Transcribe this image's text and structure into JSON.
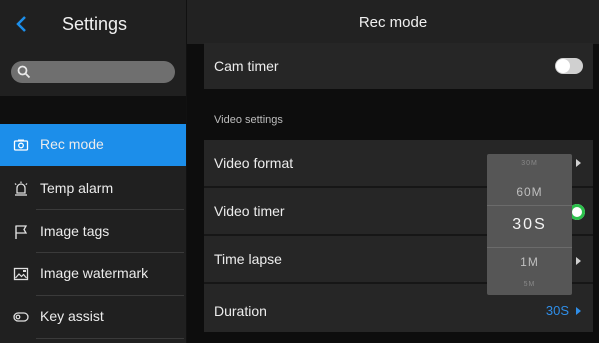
{
  "left_panel": {
    "title": "Settings",
    "search": {
      "placeholder": ""
    },
    "items": [
      {
        "label": "Rec mode",
        "icon": "camera-icon",
        "active": true
      },
      {
        "label": "Temp alarm",
        "icon": "alarm-icon",
        "active": false
      },
      {
        "label": "Image tags",
        "icon": "flag-icon",
        "active": false
      },
      {
        "label": "Image watermark",
        "icon": "watermark-icon",
        "active": false
      },
      {
        "label": "Key assist",
        "icon": "key-assist-icon",
        "active": false
      }
    ]
  },
  "right_panel": {
    "title": "Rec mode",
    "cam_timer": {
      "label": "Cam timer",
      "enabled": false
    },
    "section_title": "Video settings",
    "video_format": {
      "label": "Video format"
    },
    "video_timer": {
      "label": "Video timer",
      "enabled": true
    },
    "time_lapse": {
      "label": "Time lapse"
    },
    "duration": {
      "label": "Duration",
      "value": "30S"
    }
  },
  "picker": {
    "options": [
      "30M",
      "60M",
      "30S",
      "1M",
      "5M"
    ],
    "selected": "30S"
  },
  "colors": {
    "accent": "#1c8eea",
    "toggle_on": "#2bc04b",
    "value_blue": "#2f8ee8"
  }
}
